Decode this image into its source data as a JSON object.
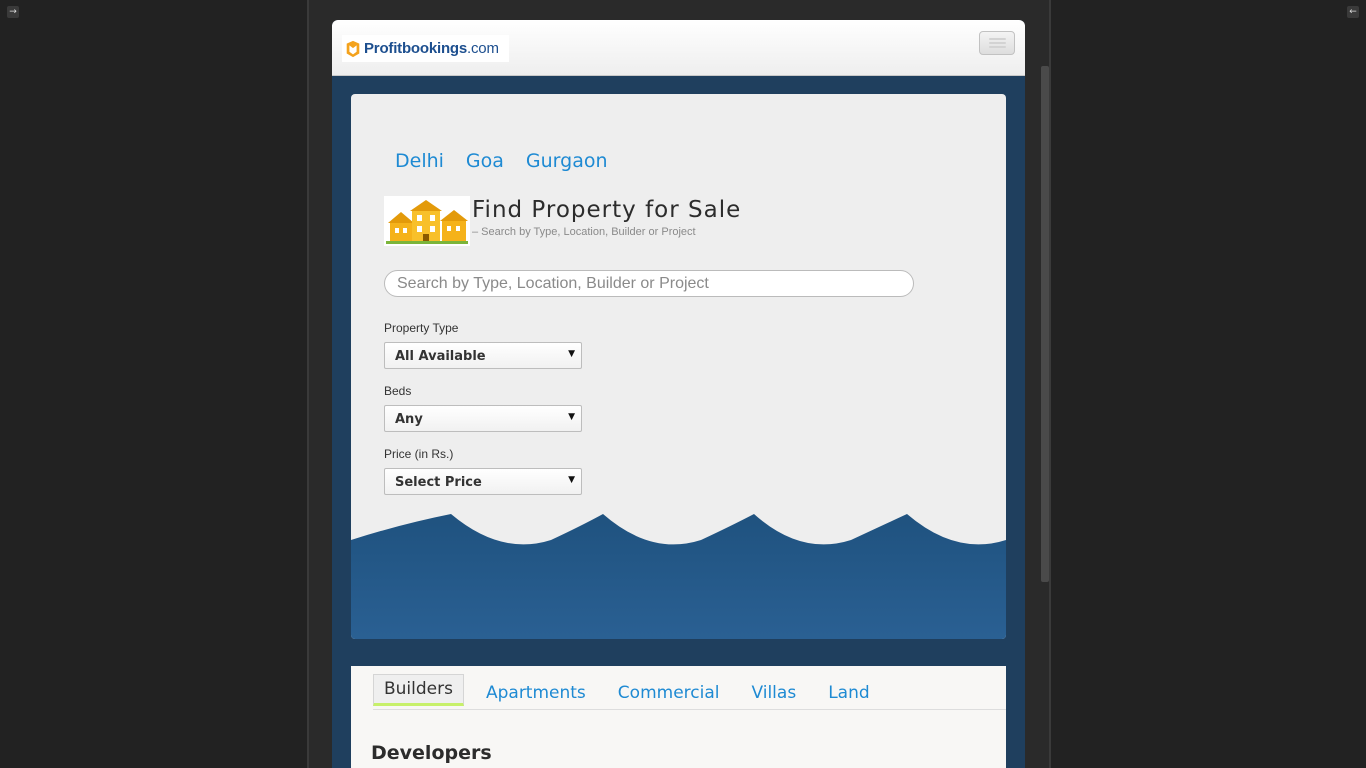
{
  "site": {
    "logo_name": "Profitbookings",
    "logo_domain": ".com"
  },
  "cities": [
    "Delhi",
    "Goa",
    "Gurgaon"
  ],
  "find": {
    "title": "Find Property for Sale",
    "subtitle": "– Search by Type, Location, Builder or Project"
  },
  "search": {
    "placeholder": "Search by Type, Location, Builder or Project"
  },
  "filters": {
    "property_type_label": "Property Type",
    "property_type_value": "All Available",
    "beds_label": "Beds",
    "beds_value": "Any",
    "price_label": "Price (in Rs.)",
    "price_value": "Select Price"
  },
  "tabs": {
    "builders": "Builders",
    "apartments": "Apartments",
    "commercial": "Commercial",
    "villas": "Villas",
    "land": "Land"
  },
  "section": {
    "title": "Developers"
  },
  "colors": {
    "link": "#1e8ad3",
    "wave": "#245b8a",
    "page_bg": "#1f3f5e",
    "active_tab_underline": "#c7f06a"
  }
}
